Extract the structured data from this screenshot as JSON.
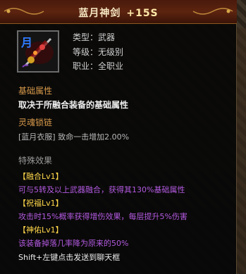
{
  "item": {
    "name": "蓝月神剑",
    "enhance": "+15S",
    "icon_label": "月",
    "icon_name": "crimson-sword-icon"
  },
  "stats": {
    "type": "类型：武器",
    "level": "等级：无级别",
    "job": "职业：全职业"
  },
  "base": {
    "title": "基础属性",
    "text": "取决于所融合装备的基础属性"
  },
  "soul": {
    "title": "灵魂锁链",
    "text": "[蓝月衣服] 致命一击增加2.00%"
  },
  "special": {
    "title": "特殊效果",
    "effects": [
      {
        "name": "【融合Lv1】",
        "desc": "可与5转及以上武器融合，获得其130%基础属性"
      },
      {
        "name": "【祝福Lv1】",
        "desc": "攻击时15%概率获得增伤效果，每层提升5%伤害"
      },
      {
        "name": "【神佑Lv1】",
        "desc": "该装备掉落几率降为原来的50%"
      }
    ]
  },
  "footer": "Shift+左键点击发送到聊天框",
  "colors": {
    "title_bg": "#4a1a0c",
    "section": "#d89a4a",
    "effect_name": "#ffd84a",
    "effect_desc": "#b25ae0"
  }
}
